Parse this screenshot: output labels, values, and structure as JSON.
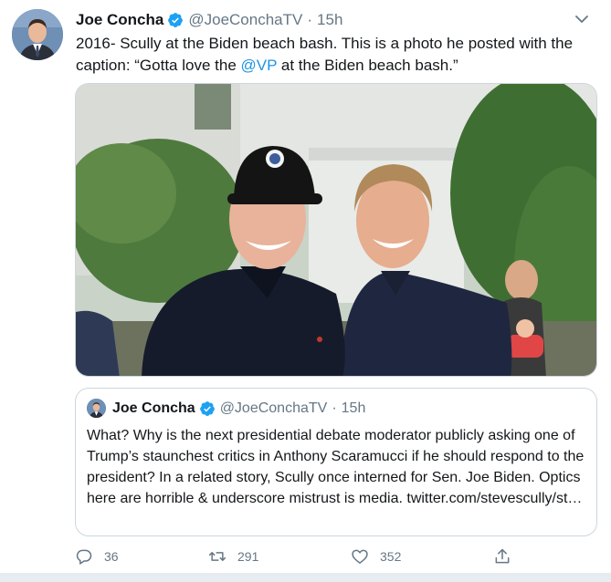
{
  "author": {
    "name": "Joe Concha",
    "handle": "@JoeConchaTV",
    "separator": "·",
    "time": "15h"
  },
  "tweet": {
    "text_before": "2016- Scully at the Biden beach bash. This is a photo he posted with the caption: “Gotta love the ",
    "mention": "@VP",
    "text_after": " at the Biden beach bash.”"
  },
  "quote": {
    "name": "Joe Concha",
    "handle": "@JoeConchaTV",
    "separator": "·",
    "time": "15h",
    "text": "What? Why is the next presidential debate moderator publicly asking one of Trump’s staunchest critics in Anthony Scaramucci if he should respond to the president? In a related story, Scully once interned for Sen. Joe Biden. Optics here are horrible & underscore mistrust is media. twitter.com/stevescully/st…"
  },
  "actions": {
    "reply_count": "36",
    "retweet_count": "291",
    "like_count": "352"
  },
  "colors": {
    "link": "#1b95e0",
    "secondary_text": "#657786",
    "border": "#ccd6dd"
  },
  "icons": [
    "verified-badge-icon",
    "chevron-down-icon",
    "reply-icon",
    "retweet-icon",
    "like-icon",
    "share-icon"
  ]
}
